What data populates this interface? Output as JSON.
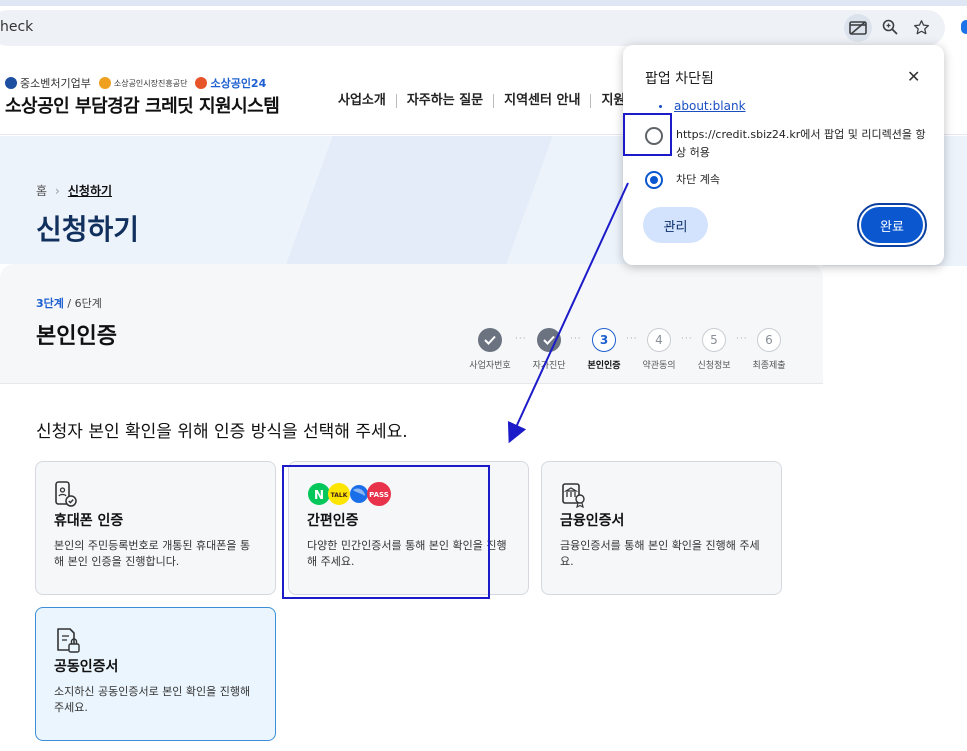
{
  "browser": {
    "url_fragment": "heck",
    "icons": [
      "popup-blocked-icon",
      "zoom-icon",
      "bookmark-star-icon"
    ]
  },
  "header": {
    "logos": [
      "중소벤처기업부",
      "소상공인시장진흥공단",
      "소상공인24"
    ],
    "site_title": "소상공인 부담경감 크레딧 지원시스템",
    "nav": [
      "사업소개",
      "자주하는 질문",
      "지역센터 안내",
      "지원"
    ]
  },
  "hero": {
    "breadcrumb_home": "홈",
    "breadcrumb_current": "신청하기",
    "title": "신청하기"
  },
  "steps_panel": {
    "current_step": "3단계",
    "total_steps": "/ 6단계",
    "title": "본인인증",
    "steps": [
      {
        "num": "",
        "label": "사업자번호",
        "state": "done"
      },
      {
        "num": "",
        "label": "자가진단",
        "state": "done"
      },
      {
        "num": "3",
        "label": "본인인증",
        "state": "active"
      },
      {
        "num": "4",
        "label": "약관동의",
        "state": "todo"
      },
      {
        "num": "5",
        "label": "신청정보",
        "state": "todo"
      },
      {
        "num": "6",
        "label": "최종제출",
        "state": "todo"
      }
    ]
  },
  "instruction": "신청자 본인 확인을 위해 인증 방식을 선택해 주세요.",
  "auth_options": [
    {
      "title": "휴대폰 인증",
      "desc": "본인의 주민등록번호로 개통된 휴대폰을 통해 본인 인증을 진행합니다."
    },
    {
      "title": "간편인증",
      "desc": "다양한 민간인증서를 통해 본인 확인을 진행해 주세요."
    },
    {
      "title": "금융인증서",
      "desc": "금융인증서를 통해 본인 확인을 진행해 주세요."
    },
    {
      "title": "공동인증서",
      "desc": "소지하신 공동인증서로 본인 확인을 진행해 주세요."
    }
  ],
  "popup": {
    "title": "팝업 차단됨",
    "link": "about:blank",
    "option_allow": "https://credit.sbiz24.kr에서 팝업 및 리디렉션을 항상 허용",
    "option_block": "차단 계속",
    "manage_label": "관리",
    "done_label": "완료"
  },
  "colors": {
    "accent_blue": "#0b57d0",
    "annotation": "#1b1bc9",
    "selected_card_bg": "#eaf5fd"
  }
}
